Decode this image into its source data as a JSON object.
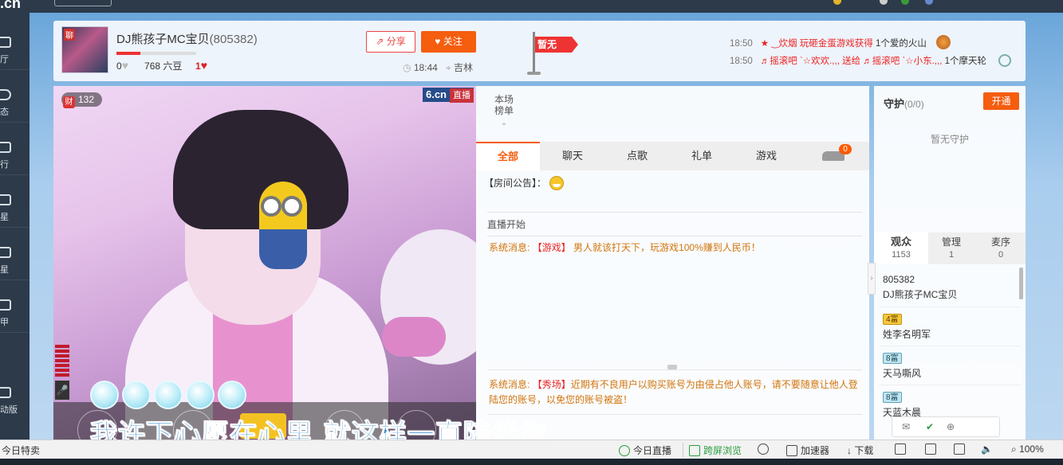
{
  "header": {
    "host_name": "DJ熊孩子MC宝贝",
    "host_id": "(805382)",
    "hearts": "0",
    "beans": "768 六豆",
    "fans": "1",
    "level_progress": 0.3,
    "share_label": "分享",
    "follow_label": "关注",
    "time": "18:44",
    "location": "吉林",
    "flag_label": "暂无"
  },
  "feed": [
    {
      "time": "18:50",
      "text": "★ ‿炊烟 玩砸金蛋游戏获得",
      "tail": "1个爱的火山"
    },
    {
      "time": "18:50",
      "text": "♬摇滚吧 ˋ☆欢欢.,,, 送给 ♬摇滚吧 ˋ☆小东.,,,",
      "tail": "1个摩天轮"
    }
  ],
  "leftnav": [
    "厅",
    "态",
    "行",
    "星",
    "星",
    "甲",
    "动版"
  ],
  "video": {
    "badge_count": "132",
    "badge_icon": "财",
    "brand": "6.cn",
    "live_tag": "直播",
    "mic": "🎤",
    "lyrics": "我许下心愿在心里 就这样一直陪伴你"
  },
  "chat": {
    "rank_label": "本场\n榜单",
    "tabs": [
      "全部",
      "聊天",
      "点歌",
      "礼单",
      "游戏"
    ],
    "active_tab": "全部",
    "car_count": "0",
    "notice": "【房间公告】：",
    "live_start": "直播开始",
    "msg1_label": "系统消息:",
    "msg1_tag": "【游戏】",
    "msg1_text": "男人就该打天下，玩游戏100%赚到人民币！",
    "msg2_label": "系统消息:",
    "msg2_tag": "【秀场】",
    "msg2_text": "近期有不良用户以购买账号为由侵占他人账号，请不要随意让他人登陆您的账号，以免您的账号被盗！"
  },
  "guard": {
    "title": "守护",
    "count": "(0/0)",
    "open_label": "开通",
    "empty": "暂无守护"
  },
  "audience": {
    "tabs": [
      {
        "label": "观众",
        "count": "1153"
      },
      {
        "label": "管理",
        "count": "1"
      },
      {
        "label": "麦序",
        "count": "0"
      }
    ],
    "users": [
      {
        "top": "805382",
        "name": "DJ熊孩子MC宝贝"
      },
      {
        "top": "4富",
        "name": "姓李名明军"
      },
      {
        "top": "8富",
        "name": "天马嘶风"
      },
      {
        "top": "8富",
        "name": "天蓝木晨"
      }
    ]
  },
  "statusbar": {
    "left": "今日特卖",
    "today_live": "今日直播",
    "cross_screen": "跨屏浏览",
    "accelerator": "加速器",
    "download": "下载",
    "zoom": "100%"
  }
}
